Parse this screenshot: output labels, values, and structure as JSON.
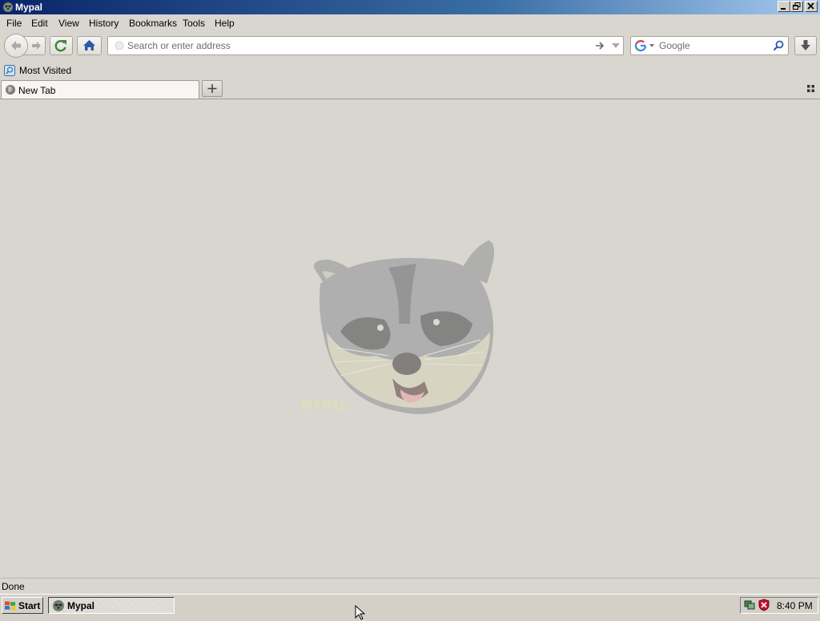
{
  "window": {
    "title": "Mypal"
  },
  "menu": [
    "File",
    "Edit",
    "View",
    "History",
    "Bookmarks",
    "Tools",
    "Help"
  ],
  "nav": {
    "url_placeholder": "Search or enter address",
    "search_placeholder": "Google",
    "search_engine_icon": "google-icon"
  },
  "bookmarks": {
    "items": [
      {
        "label": "Most Visited",
        "icon": "bookmark-folder-icon"
      }
    ]
  },
  "tabs": [
    {
      "label": "New Tab",
      "icon": "globe-icon",
      "selected": true
    }
  ],
  "content": {
    "image": "raccoon-logo",
    "logo_text": "MYPAL"
  },
  "status": {
    "text": "Done"
  },
  "taskbar": {
    "start_label": "Start",
    "task_label": "Mypal",
    "clock": "8:40 PM"
  },
  "colors": {
    "titlebar_start": "#0a246a",
    "titlebar_end": "#a6caf0",
    "home_icon": "#2b5aa6",
    "reload_icon": "#3a8a3a"
  }
}
